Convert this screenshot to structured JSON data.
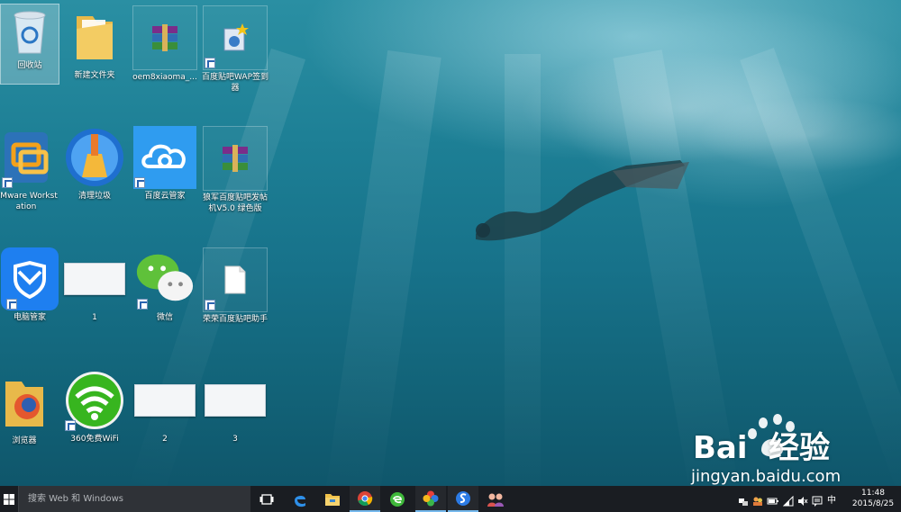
{
  "desktop": {
    "icons": [
      {
        "label": "回收站"
      },
      {
        "label": "新建文件夹"
      },
      {
        "label": "oem8xiaoma_..."
      },
      {
        "label": "百度贴吧WAP签到器"
      },
      {
        "label": "VMware Workstation"
      },
      {
        "label": "清理垃圾"
      },
      {
        "label": "百度云管家"
      },
      {
        "label": "狼军百度贴吧发帖机V5.0 绿色版"
      },
      {
        "label": "电脑管家"
      },
      {
        "label": "1"
      },
      {
        "label": "微信"
      },
      {
        "label": "荣荣百度贴吧助手"
      },
      {
        "label": "浏览器"
      },
      {
        "label": "360免费WiFi"
      },
      {
        "label": "2"
      },
      {
        "label": "3"
      }
    ]
  },
  "watermark": {
    "brand": "Bai  经验",
    "url": "jingyan.baidu.com"
  },
  "taskbar": {
    "search_placeholder": "搜索 Web 和 Windows",
    "pinned": [
      "task-view-icon",
      "edge-icon",
      "file-explorer-icon",
      "chrome-icon",
      "360-browser-icon",
      "color-app-icon",
      "sogou-icon",
      "people-app-icon"
    ],
    "input_indicator": "中",
    "time": "11:48",
    "date": "2015/8/25"
  },
  "colors": {
    "taskbar": "#1a1d22",
    "accent": "#76b9ed",
    "water": "#1d7f95"
  }
}
